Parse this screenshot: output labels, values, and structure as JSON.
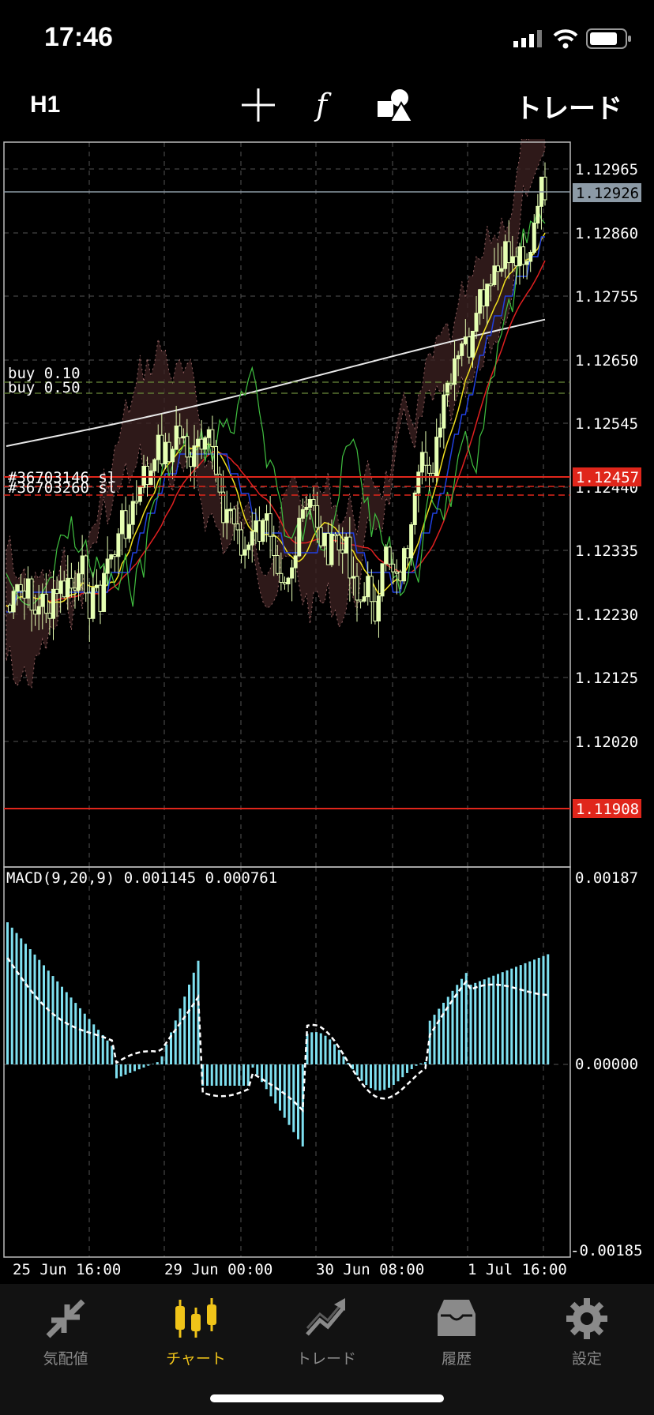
{
  "status_bar": {
    "time": "17:46"
  },
  "toolbar": {
    "timeframe": "H1",
    "trade_label": "トレード",
    "icons": [
      "crosshair-icon",
      "function-icon",
      "objects-icon"
    ]
  },
  "price_axis": [
    "1.12965",
    "1.12860",
    "1.12755",
    "1.12650",
    "1.12545",
    "1.12440",
    "1.12335",
    "1.12230",
    "1.12125",
    "1.12020"
  ],
  "price_tags": {
    "current": "1.12926",
    "current_color": "#8c9aa6",
    "sl": "1.12457",
    "low": "1.11908",
    "tag_color": "#e0261b"
  },
  "orders": {
    "buy1": "buy 0.10",
    "buy2": "buy 0.50",
    "sl1": "#36703146 sl",
    "sl2": "#36703260 sl"
  },
  "macd": {
    "label": "MACD(9,20,9) 0.001145 0.000761",
    "axis": [
      "0.00187",
      "0.00000",
      "-0.00185"
    ]
  },
  "time_axis": [
    "25 Jun 16:00",
    "29 Jun 00:00",
    "30 Jun 08:00",
    "1 Jul 16:00"
  ],
  "tabs": [
    {
      "label": "気配値",
      "icon": "quotes-icon"
    },
    {
      "label": "チャート",
      "icon": "chart-icon",
      "active": true
    },
    {
      "label": "トレード",
      "icon": "trade-icon"
    },
    {
      "label": "履歴",
      "icon": "history-icon"
    },
    {
      "label": "設定",
      "icon": "settings-icon"
    }
  ],
  "colors": {
    "accent": "#f0c419",
    "candle": "#e6ffb3",
    "macd_hist": "#7fe0f0"
  }
}
